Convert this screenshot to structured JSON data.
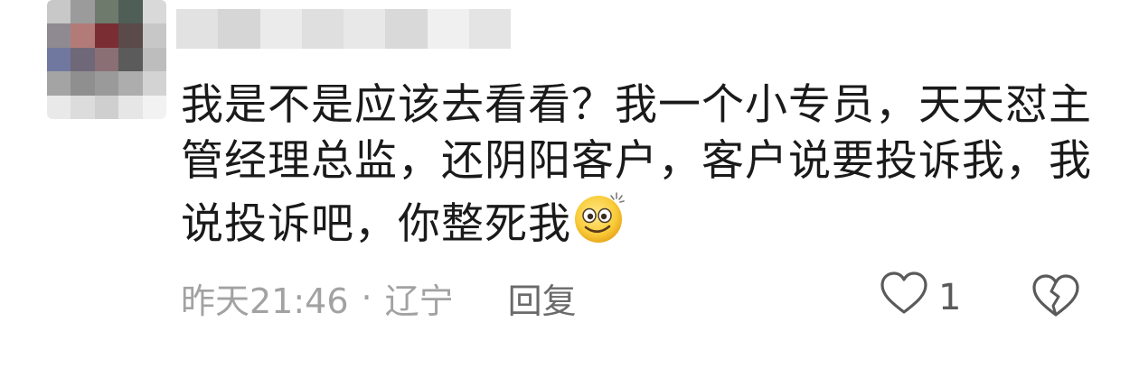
{
  "comment": {
    "avatar": {
      "blurred": true,
      "colors": [
        "#c8c8c8",
        "#9b9b9b",
        "#6e7a6c",
        "#4f5e56",
        "#d9d9d9",
        "#8f8a92",
        "#b37b78",
        "#7b2d34",
        "#5b4a4a",
        "#c7c7c7",
        "#7078a0",
        "#6f6878",
        "#8a6f74",
        "#5b5b5b",
        "#bdbdbd",
        "#a4a4a4",
        "#8f8f8f",
        "#9a9a9a",
        "#adadad",
        "#d3d3d3",
        "#e9e9e9",
        "#dcdcdc",
        "#cfcfcf",
        "#e6e6e6",
        "#f2f2f2"
      ]
    },
    "username": {
      "blurred": true,
      "colors": [
        "#e2e2e2",
        "#d6d6d6",
        "#ebebeb",
        "#dfdfdf",
        "#e8e8e8",
        "#d9d9d9",
        "#f0f0f0",
        "#e4e4e4"
      ]
    },
    "text": "我是不是应该去看看？我一个小专员，天天怼主管经理总监，还阴阳客户，客户说要投诉我，我说投诉吧，你整死我",
    "emoji_icon": "dizzy-smile-emoji",
    "time": "昨天21:46",
    "separator": "·",
    "location": "辽宁",
    "reply_label": "回复",
    "like_count": "1",
    "like_icon": "heart-outline-icon",
    "dislike_icon": "broken-heart-icon",
    "colors": {
      "text": "#1a1a1a",
      "meta": "#a2a2a2",
      "reply": "#6a6a6a",
      "icon": "#5a5a5a"
    }
  }
}
